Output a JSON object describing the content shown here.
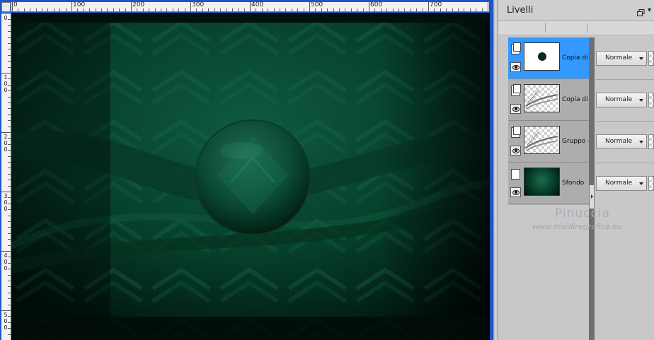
{
  "ruler": {
    "top_labels": [
      "0",
      "100",
      "200",
      "300",
      "400",
      "500",
      "600",
      "700"
    ],
    "left_labels": [
      [
        "0"
      ],
      [
        "1",
        "0",
        "0"
      ],
      [
        "2",
        "0",
        "0"
      ],
      [
        "3",
        "0",
        "0"
      ],
      [
        "4",
        "0",
        "0"
      ],
      [
        "5",
        "0",
        "0"
      ]
    ]
  },
  "canvas": {
    "description_colors": {
      "base": "#021a10",
      "emerald": "#0b5a3f",
      "highlight": "#1f7a5a"
    }
  },
  "layers_panel": {
    "title": "Livelli",
    "float_icon": "restore-window-icon",
    "menu_icon": "chevron-down-icon",
    "layers": [
      {
        "name": "Copia di S",
        "blend_mode": "Normale",
        "selected": true,
        "thumb": "dark-ball-on-transparent"
      },
      {
        "name": "Copia di G",
        "blend_mode": "Normale",
        "selected": false,
        "thumb": "wave-on-transparent"
      },
      {
        "name": "Gruppo - ",
        "blend_mode": "Normale",
        "selected": false,
        "thumb": "wave-on-transparent"
      },
      {
        "name": "Sfondo",
        "blend_mode": "Normale",
        "selected": false,
        "thumb": "green-background"
      }
    ]
  },
  "watermark": {
    "title": "Pinuccia",
    "site": "www.maidiregrafica.eu"
  },
  "colors": {
    "selection": "#3399ff",
    "window_frame": "#1f53c8",
    "panel_bg": "#c8c8c8"
  }
}
